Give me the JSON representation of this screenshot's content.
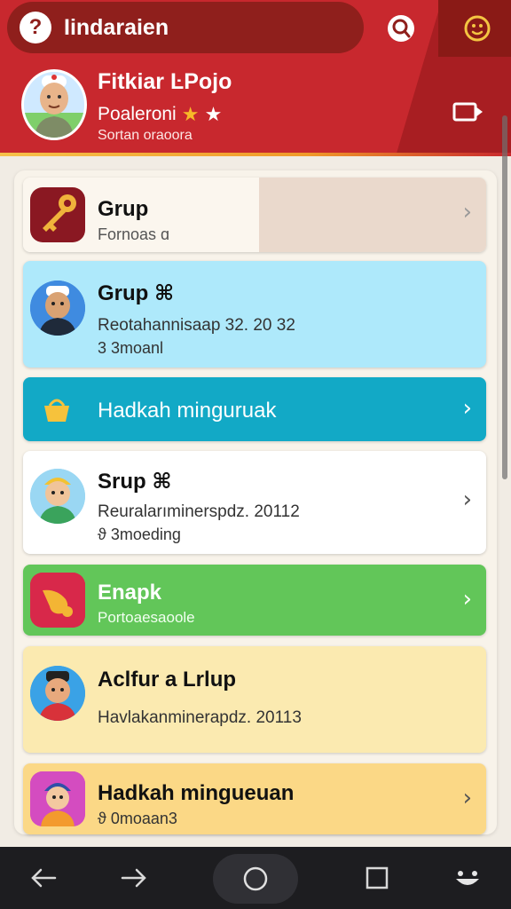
{
  "header": {
    "app_title": "Iindaraien",
    "search_badge": "?",
    "profile": {
      "name": "Fitkiar ĿPojo",
      "status": "Poaleroni",
      "stars": [
        "★",
        "★"
      ],
      "meta": "Sortan oraoora"
    }
  },
  "colors": {
    "header_red": "#c8282e",
    "card_light_blue": "#aee9fb",
    "card_teal": "#12a9c6",
    "card_green": "#62c659",
    "card_yellow": "#fbeab0",
    "card_orange": "#fbd886"
  },
  "icons": {
    "search": "magnifier-icon",
    "emoji": "smiley-icon",
    "logout": "exit-icon",
    "chevron": "chevron-right-icon"
  },
  "cards": [
    {
      "title": "Grup",
      "line1": "Fornoas ɑ",
      "chevron": "›"
    },
    {
      "title": "Grup ⌘",
      "line1": "Reotahannisaap 32. 20 32",
      "line2": "3 3moanl"
    },
    {
      "title": "Hadkah minguruak",
      "chevron": "›"
    },
    {
      "title": "Srup ⌘",
      "line1": "Reuralarıminerspdz. 20112",
      "line2": "ϑ 3moeding",
      "chevron": "›"
    },
    {
      "title": "Enapk",
      "line1": "Portoaesaoole",
      "chevron": "›"
    },
    {
      "title": "Aclfur a Lrlup",
      "line1": "Havlakanminerapdz. 20113"
    },
    {
      "title": "Hadkah mingueuan",
      "line1": "ϑ 0moaan3",
      "chevron": "›"
    }
  ],
  "nav": {
    "back": "back-arrow-icon",
    "forward": "forward-arrow-icon",
    "home": "home-circle-icon",
    "recents": "recents-square-icon",
    "assistant": "face-icon"
  }
}
